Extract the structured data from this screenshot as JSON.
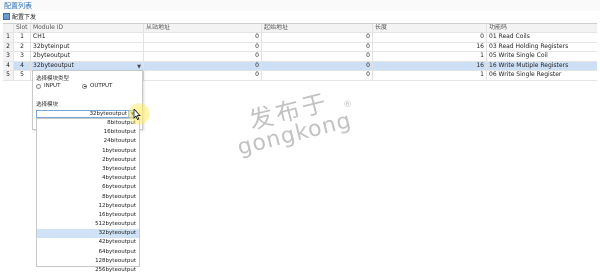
{
  "window": {
    "title": "配置列表"
  },
  "toolbar": {
    "download_label": "配置下发"
  },
  "grid": {
    "columns": [
      "",
      "Slot",
      "Module ID",
      "从站地址",
      "起始地址",
      "长度",
      "功能码"
    ],
    "rows": [
      {
        "idx": "1",
        "slot": "1",
        "module": "CH1",
        "slave": "0",
        "start": "0",
        "length": "0",
        "func": "01 Read Coils"
      },
      {
        "idx": "2",
        "slot": "2",
        "module": "32byteinput",
        "slave": "0",
        "start": "0",
        "length": "16",
        "func": "03 Read Holding Registers"
      },
      {
        "idx": "3",
        "slot": "3",
        "module": "2byteoutput",
        "slave": "0",
        "start": "0",
        "length": "1",
        "func": "05 Write Single Coil"
      },
      {
        "idx": "4",
        "slot": "4",
        "module": "32byteoutput",
        "slave": "0",
        "start": "0",
        "length": "16",
        "func": "16 Write Mutiple Registers"
      },
      {
        "idx": "5",
        "slot": "5",
        "module": "",
        "slave": "0",
        "start": "0",
        "length": "1",
        "func": "06 Write Single Register"
      }
    ]
  },
  "popup": {
    "type_label": "选择模块类型",
    "input_label": "INPUT",
    "output_label": "OUTPUT",
    "selected_type": "OUTPUT",
    "module_label": "选择模块",
    "module_value": "32byteoutput"
  },
  "options": [
    "8bitoutput",
    "16bitoutput",
    "24bitoutput",
    "1byteoutput",
    "2byteoutput",
    "3byteoutput",
    "4byteoutput",
    "6byteoutput",
    "8byteoutput",
    "12byteoutput",
    "16byteoutput",
    "512byteoutput",
    "32byteoutput",
    "42byteoutput",
    "64byteoutput",
    "128byteoutput",
    "256byteoutput"
  ],
  "selected_option": "32byteoutput",
  "watermark": {
    "cn": "发布于",
    "en": "gongkong",
    "reg": "®"
  }
}
